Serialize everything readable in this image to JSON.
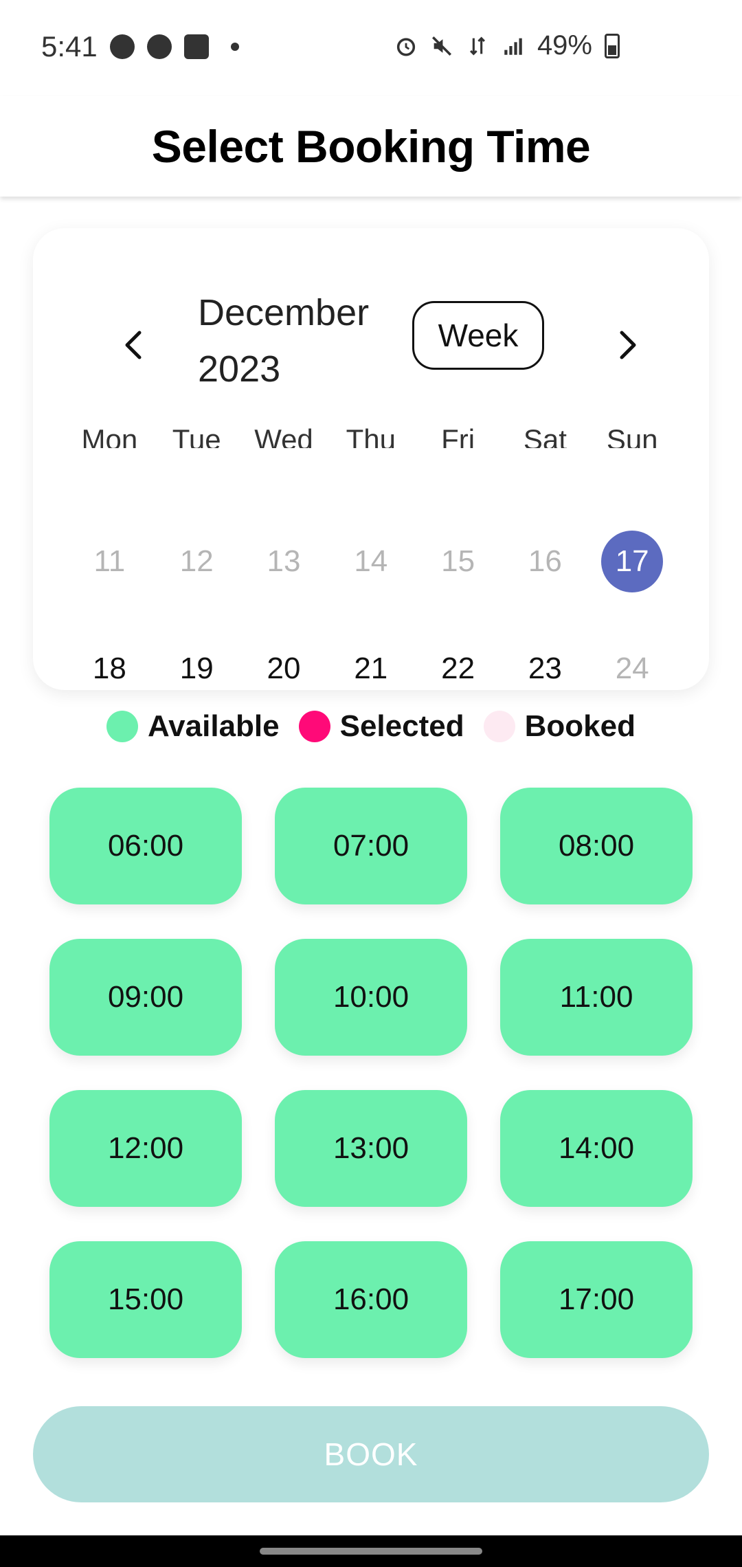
{
  "status_bar": {
    "time": "5:41",
    "battery": "49%",
    "left_icons": [
      "soccer-icon",
      "spotify-icon",
      "gallery-icon"
    ],
    "right_icons": [
      "alarm-icon",
      "mute-icon",
      "data-icon",
      "signal-icon",
      "battery-icon"
    ]
  },
  "header": {
    "title": "Select Booking Time"
  },
  "calendar": {
    "month_label": "December 2023",
    "view_toggle": "Week",
    "weekdays": [
      "Mon",
      "Tue",
      "Wed",
      "Thu",
      "Fri",
      "Sat",
      "Sun"
    ],
    "week1": [
      "11",
      "12",
      "13",
      "14",
      "15",
      "16",
      "17"
    ],
    "week2": [
      "18",
      "19",
      "20",
      "21",
      "22",
      "23",
      "24"
    ],
    "selected_date": "17"
  },
  "legend": {
    "available": {
      "label": "Available",
      "color": "#6cf0ae"
    },
    "selected": {
      "label": "Selected",
      "color": "#ff0a78"
    },
    "booked": {
      "label": "Booked",
      "color": "#fdeaf2"
    }
  },
  "slots": [
    "06:00",
    "07:00",
    "08:00",
    "09:00",
    "10:00",
    "11:00",
    "12:00",
    "13:00",
    "14:00",
    "15:00",
    "16:00",
    "17:00"
  ],
  "book_button": {
    "label": "BOOK"
  },
  "colors": {
    "accent": "#5c6bc0",
    "book_disabled": "#b2dfdc",
    "slot_available": "#6cf0ae"
  }
}
